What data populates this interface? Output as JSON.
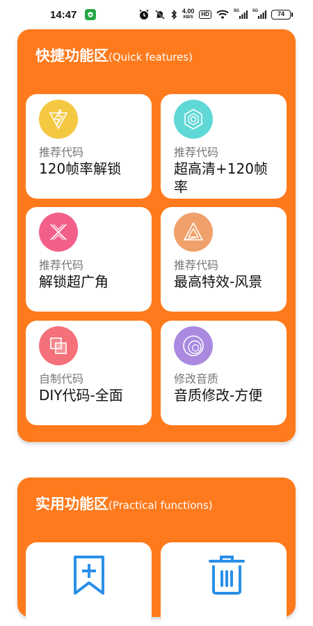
{
  "status_bar": {
    "time": "14:47",
    "speed_value": "4.00",
    "speed_unit": "KB/S",
    "hd_label": "HD",
    "network_1": "5G",
    "network_2": "5G",
    "battery": "74"
  },
  "quick": {
    "title_zh": "快捷功能区",
    "title_en": "(Quick features)",
    "cards": [
      {
        "category": "推荐代码",
        "name": "120帧率解锁",
        "icon": "lightning-icon",
        "color": "#f5c842"
      },
      {
        "category": "推荐代码",
        "name": "超高清+120帧率",
        "icon": "hexagon-icon",
        "color": "#5fd8d6"
      },
      {
        "category": "推荐代码",
        "name": "解锁超广角",
        "icon": "cross-arrows-icon",
        "color": "#f2608a"
      },
      {
        "category": "推荐代码",
        "name": "最高特效-风景",
        "icon": "triangle-icon",
        "color": "#f0a06a"
      },
      {
        "category": "自制代码",
        "name": "DIY代码-全面",
        "icon": "squares-icon",
        "color": "#f4707a"
      },
      {
        "category": "修改音质",
        "name": "音质修改-方便",
        "icon": "rings-icon",
        "color": "#a98ae0"
      }
    ]
  },
  "practical": {
    "title_zh": "实用功能区",
    "title_en": "(Practical functions)",
    "cards": [
      {
        "icon": "bookmark-add-icon"
      },
      {
        "icon": "trash-icon"
      }
    ],
    "icon_color": "#2a8fe8"
  }
}
